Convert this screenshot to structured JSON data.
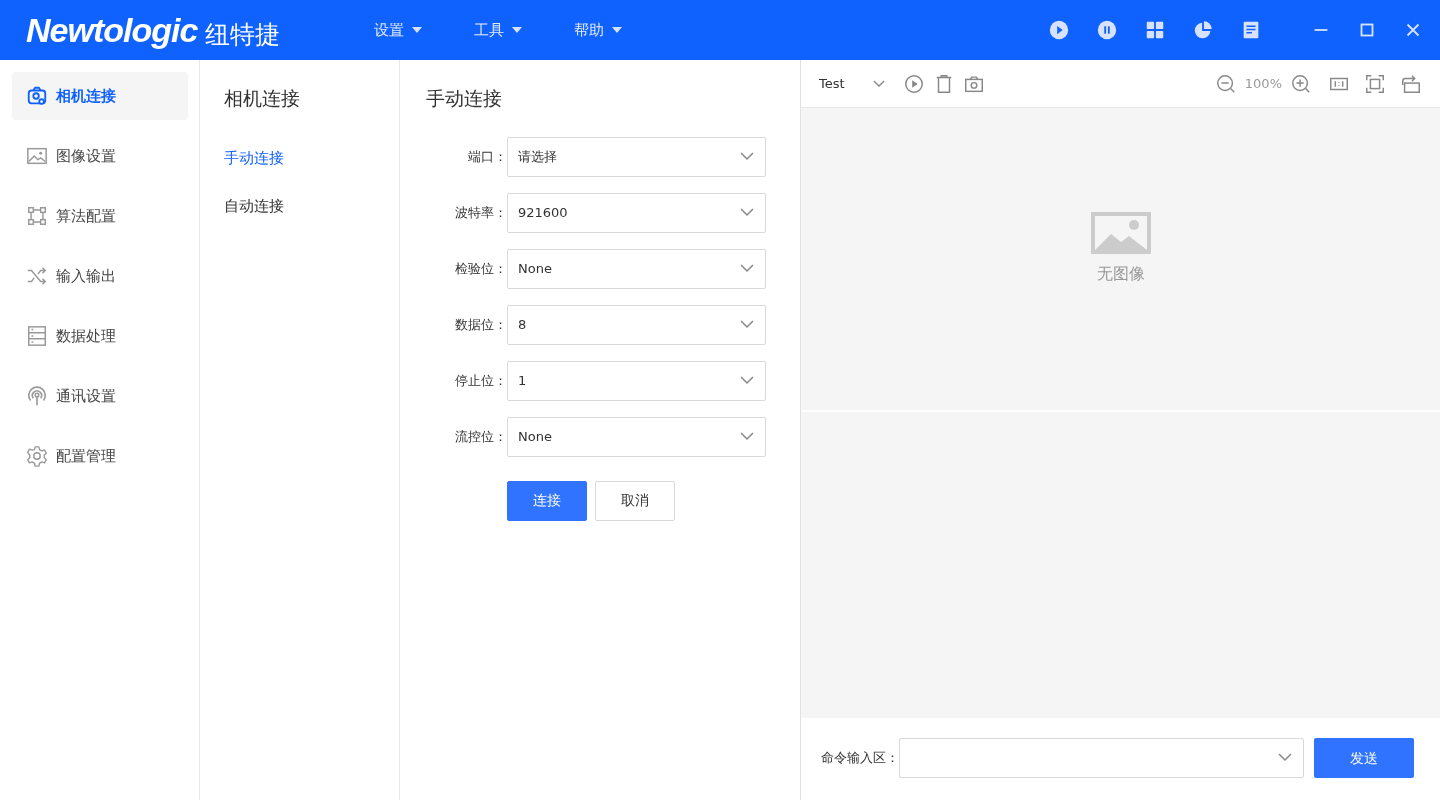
{
  "header": {
    "logo": "Newtologic",
    "logo_cn": "纽特捷",
    "menus": [
      "设置",
      "工具",
      "帮助"
    ]
  },
  "sidebar": {
    "items": [
      {
        "label": "相机连接",
        "selected": true
      },
      {
        "label": "图像设置",
        "selected": false
      },
      {
        "label": "算法配置",
        "selected": false
      },
      {
        "label": "输入输出",
        "selected": false
      },
      {
        "label": "数据处理",
        "selected": false
      },
      {
        "label": "通讯设置",
        "selected": false
      },
      {
        "label": "配置管理",
        "selected": false
      }
    ]
  },
  "subnav": {
    "title": "相机连接",
    "items": [
      {
        "label": "手动连接",
        "selected": true
      },
      {
        "label": "自动连接",
        "selected": false
      }
    ]
  },
  "form": {
    "title": "手动连接",
    "fields": [
      {
        "label": "端口：",
        "placeholder": "请选择"
      },
      {
        "label": "波特率：",
        "value": "921600"
      },
      {
        "label": "检验位：",
        "value": "None"
      },
      {
        "label": "数据位：",
        "value": "8"
      },
      {
        "label": "停止位：",
        "value": "1"
      },
      {
        "label": "流控位：",
        "value": "None"
      }
    ],
    "buttons": [
      {
        "label": "连接",
        "kind": "primary"
      },
      {
        "label": "取消",
        "kind": "default"
      }
    ]
  },
  "viewer": {
    "source": "Test",
    "zoom": "100%",
    "empty_text": "无图像"
  },
  "command": {
    "label": "命令输入区：",
    "send": "发送"
  }
}
